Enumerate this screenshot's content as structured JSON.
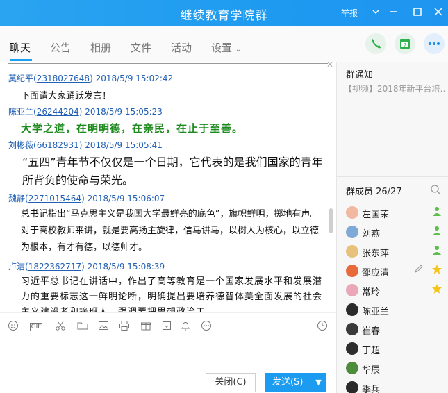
{
  "window": {
    "title": "继续教育学院群",
    "report": "举报",
    "icons": {
      "menu": "chevron-down-icon",
      "minimize": "minimize-icon",
      "maximize": "maximize-icon",
      "close": "close-icon"
    }
  },
  "tabs": [
    "聊天",
    "公告",
    "相册",
    "文件",
    "活动",
    "设置"
  ],
  "messages": [
    {
      "sender": "莫纪平",
      "qq": "2318027648",
      "time": "2018/5/9 15:02:42",
      "text": "下面请大家踊跃发言！",
      "style": "plain"
    },
    {
      "sender": "陈亚兰",
      "qq": "26244204",
      "time": "2018/5/9 15:05:23",
      "text": "大学之道，在明明德，在亲民，在止于至善。",
      "style": "green-bold"
    },
    {
      "sender": "刘彬薇",
      "qq": "66182931",
      "time": "2018/5/9 15:05:41",
      "text": "“五四”青年节不仅仅是一个日期，它代表的是我们国家的青年所背负的使命与荣光。",
      "style": "large"
    },
    {
      "sender": "魏静",
      "qq": "2271015464",
      "time": "2018/5/9 15:06:07",
      "text": "总书记指出“马克思主义是我国大学最鲜亮的底色”，旗帜鲜明，掷地有声。对于高校教师来讲，就是要高扬主旋律，信马讲马，以树人为核心，以立德为根本，有才有德，以德帅才。",
      "style": "plain"
    },
    {
      "sender": "卢洁",
      "qq": "1822362717",
      "time": "2018/5/9 15:08:39",
      "text": "习近平总书记在讲话中，作出了高等教育是一个国家发展水平和发展潜力的重要标志这一鲜明论断，明确提出要培养德智体美全面发展的社会主义建设者和接班人，强调要把思想政治工",
      "style": "serif"
    }
  ],
  "toolbar": {
    "icons": [
      "emoji-icon",
      "gif-icon",
      "scissors-icon",
      "folder-icon",
      "image-icon",
      "print-icon",
      "gift-icon",
      "calendar-icon",
      "bell-icon",
      "more-icon",
      "history-icon"
    ],
    "gif_label": "GIF"
  },
  "buttons": {
    "close": "关闭(C)",
    "send": "发送(S)"
  },
  "sidebar": {
    "notice_title": "群通知",
    "notice_text": "【视频】2018年新平台培…",
    "members_title": "群成员 26/27",
    "members": [
      {
        "name": "左国荣",
        "badge": "admin"
      },
      {
        "name": "刘燕",
        "badge": "admin"
      },
      {
        "name": "张东萍",
        "badge": "admin"
      },
      {
        "name": "邵应清",
        "badge": "star-edit"
      },
      {
        "name": "常玲",
        "badge": "star"
      },
      {
        "name": "陈亚兰",
        "badge": ""
      },
      {
        "name": "崔春",
        "badge": ""
      },
      {
        "name": "丁超",
        "badge": ""
      },
      {
        "name": "华辰",
        "badge": ""
      },
      {
        "name": "季兵",
        "badge": ""
      }
    ]
  },
  "colors": {
    "titlebar": "#1e9af0",
    "link": "#2160b5",
    "green_text": "#1e8a1e",
    "send_button": "#1b9cf0"
  }
}
